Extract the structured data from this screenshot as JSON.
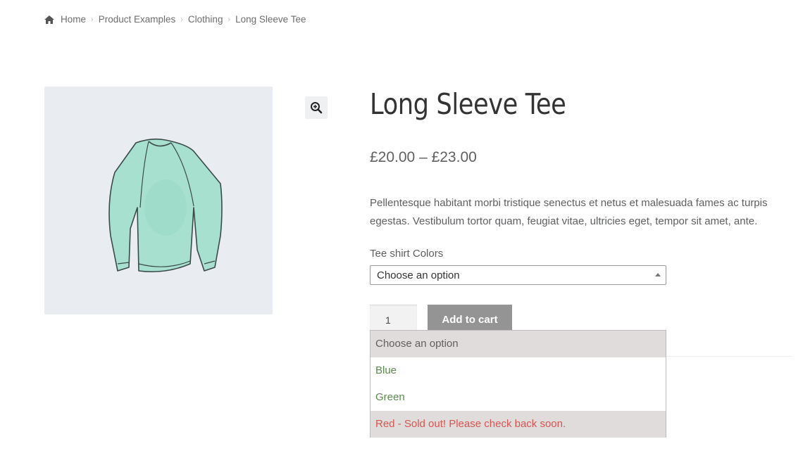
{
  "breadcrumb": {
    "icon": "home-icon",
    "items": [
      "Home",
      "Product Examples",
      "Clothing",
      "Long Sleeve Tee"
    ]
  },
  "product": {
    "title": "Long Sleeve Tee",
    "price": "£20.00 – £23.00",
    "description": "Pellentesque habitant morbi tristique senectus et netus et malesuada fames ac turpis egestas. Vestibulum tortor quam, feugiat vitae, ultricies eget, tempor sit amet, ante.",
    "image_icon": "long-sleeve-shirt-image",
    "image_color": "#a8e0cf",
    "zoom_icon": "zoom-in-icon"
  },
  "variation": {
    "label": "Tee shirt Colors",
    "selected": "Choose an option",
    "options": [
      {
        "label": "Choose an option",
        "state": "placeholder"
      },
      {
        "label": "Blue",
        "state": "available"
      },
      {
        "label": "Green",
        "state": "available"
      },
      {
        "label": "Red - Sold out! Please check back soon.",
        "state": "soldout"
      }
    ]
  },
  "cart": {
    "quantity": "1",
    "add_label": "Add to cart"
  },
  "colors": {
    "available": "#5b8a4d",
    "soldout": "#d9534f",
    "button": "#949494",
    "image_bg": "#e9edf1"
  }
}
